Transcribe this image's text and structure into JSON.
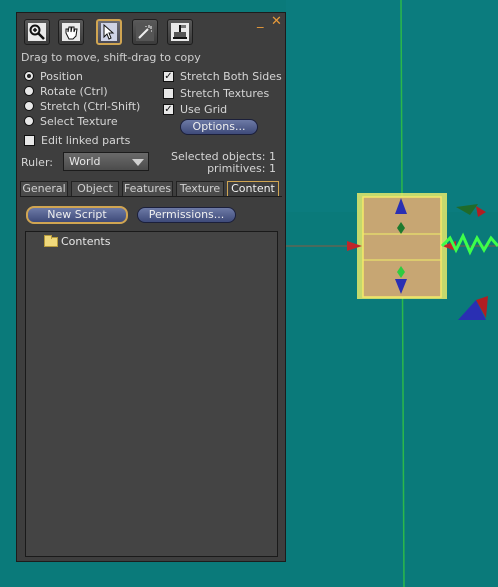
{
  "hint": "Drag to move, shift-drag to copy",
  "tools": [
    {
      "icon": "magnifier-icon"
    },
    {
      "icon": "hand-icon"
    },
    {
      "icon": "pointer-icon"
    },
    {
      "icon": "magic-wand-icon"
    },
    {
      "icon": "land-icon"
    }
  ],
  "controls": {
    "minimize": "_",
    "close": "✕"
  },
  "modes": {
    "position": "Position",
    "rotate": "Rotate (Ctrl)",
    "stretch": "Stretch (Ctrl-Shift)",
    "select_texture": "Select Texture",
    "selected": "Position"
  },
  "edit_linked": {
    "label": "Edit linked parts",
    "checked": false
  },
  "options": {
    "stretch_both": {
      "label": "Stretch Both Sides",
      "checked": true
    },
    "stretch_textures": {
      "label": "Stretch Textures",
      "checked": false
    },
    "use_grid": {
      "label": "Use Grid",
      "checked": true
    },
    "options_button": "Options..."
  },
  "ruler": {
    "label": "Ruler:",
    "value": "World"
  },
  "stats": {
    "selected": "Selected objects: 1",
    "primitives": "primitives: 1"
  },
  "tabs": [
    "General",
    "Object",
    "Features",
    "Texture",
    "Content"
  ],
  "active_tab": "Content",
  "content": {
    "new_script": "New Script",
    "permissions": "Permissions...",
    "tree_item": "Contents"
  },
  "colors": {
    "water": "#0a7a7a",
    "panel": "#3e3e3e",
    "accent": "#d0a552",
    "title_controls": "#e79a3a"
  }
}
